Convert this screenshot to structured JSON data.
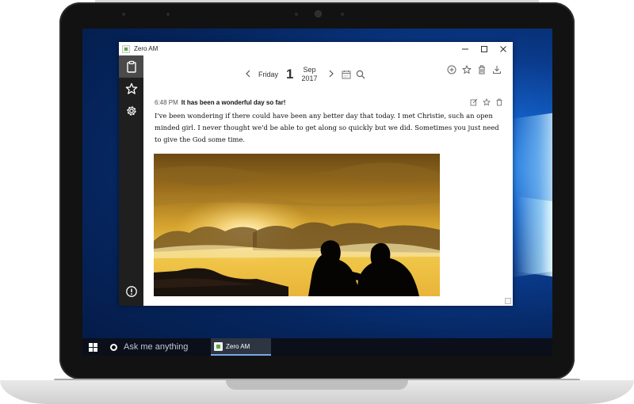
{
  "window": {
    "title": "Zero AM",
    "controls": [
      "minimize",
      "maximize",
      "close"
    ]
  },
  "sidebar": {
    "items": [
      {
        "icon": "clipboard-icon",
        "active": true
      },
      {
        "icon": "star-icon",
        "active": false
      },
      {
        "icon": "gear-icon",
        "active": false
      }
    ],
    "bottom_icon": "alert-icon"
  },
  "date_nav": {
    "day_name": "Friday",
    "day_number": "1",
    "month": "Sep",
    "year": "2017"
  },
  "top_actions": [
    "add-icon",
    "star-icon",
    "trash-icon",
    "download-icon"
  ],
  "entry": {
    "time": "6:48 PM",
    "title": "It has been a wonderful day so far!",
    "body": "I've been wondering if there could have been any better day that today. I met Christie, such an open minded girl. I never thought we'd be able to get along so quickly but we did. Sometimes you just need to give the God some time.",
    "actions": [
      "edit-icon",
      "star-icon",
      "trash-icon"
    ]
  },
  "taskbar": {
    "search_placeholder": "Ask me anything",
    "app_label": "Zero AM"
  }
}
